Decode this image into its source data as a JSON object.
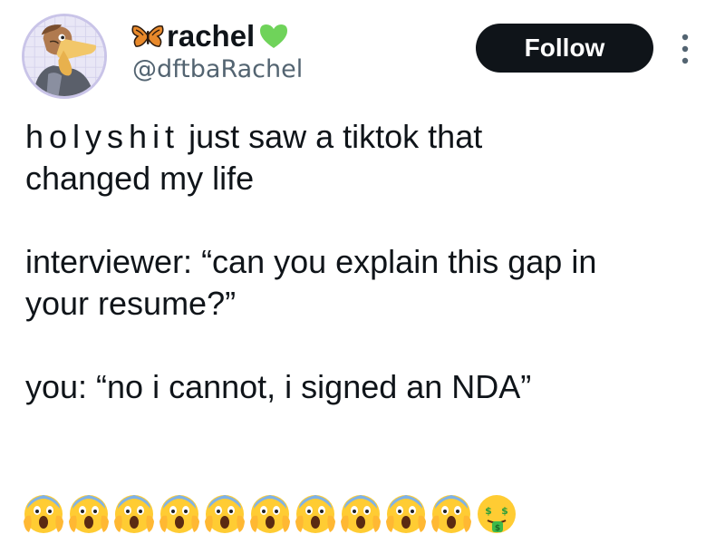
{
  "user": {
    "display_name": "rachel",
    "handle": "@dftbaRachel",
    "name_emoji_left": "butterfly-icon",
    "name_emoji_right": "green-heart-icon"
  },
  "actions": {
    "follow_label": "Follow",
    "more_icon": "more-vertical-icon"
  },
  "tweet": {
    "line1_spaced": "holyshit",
    "line1_rest": "just saw a tiktok that",
    "line2": "changed my life",
    "line3": "interviewer: “can you explain this gap in",
    "line4": "your resume?”",
    "line5": "you: “no i cannot, i signed an NDA”",
    "emojis": [
      "face-screaming-in-fear-icon",
      "face-screaming-in-fear-icon",
      "face-screaming-in-fear-icon",
      "face-screaming-in-fear-icon",
      "face-screaming-in-fear-icon",
      "face-screaming-in-fear-icon",
      "face-screaming-in-fear-icon",
      "face-screaming-in-fear-icon",
      "face-screaming-in-fear-icon",
      "face-screaming-in-fear-icon",
      "money-mouth-face-icon"
    ]
  },
  "colors": {
    "text": "#0f1419",
    "secondary_text": "#536471",
    "follow_bg": "#0f1419",
    "follow_text": "#ffffff",
    "heart": "#6fd35a"
  }
}
